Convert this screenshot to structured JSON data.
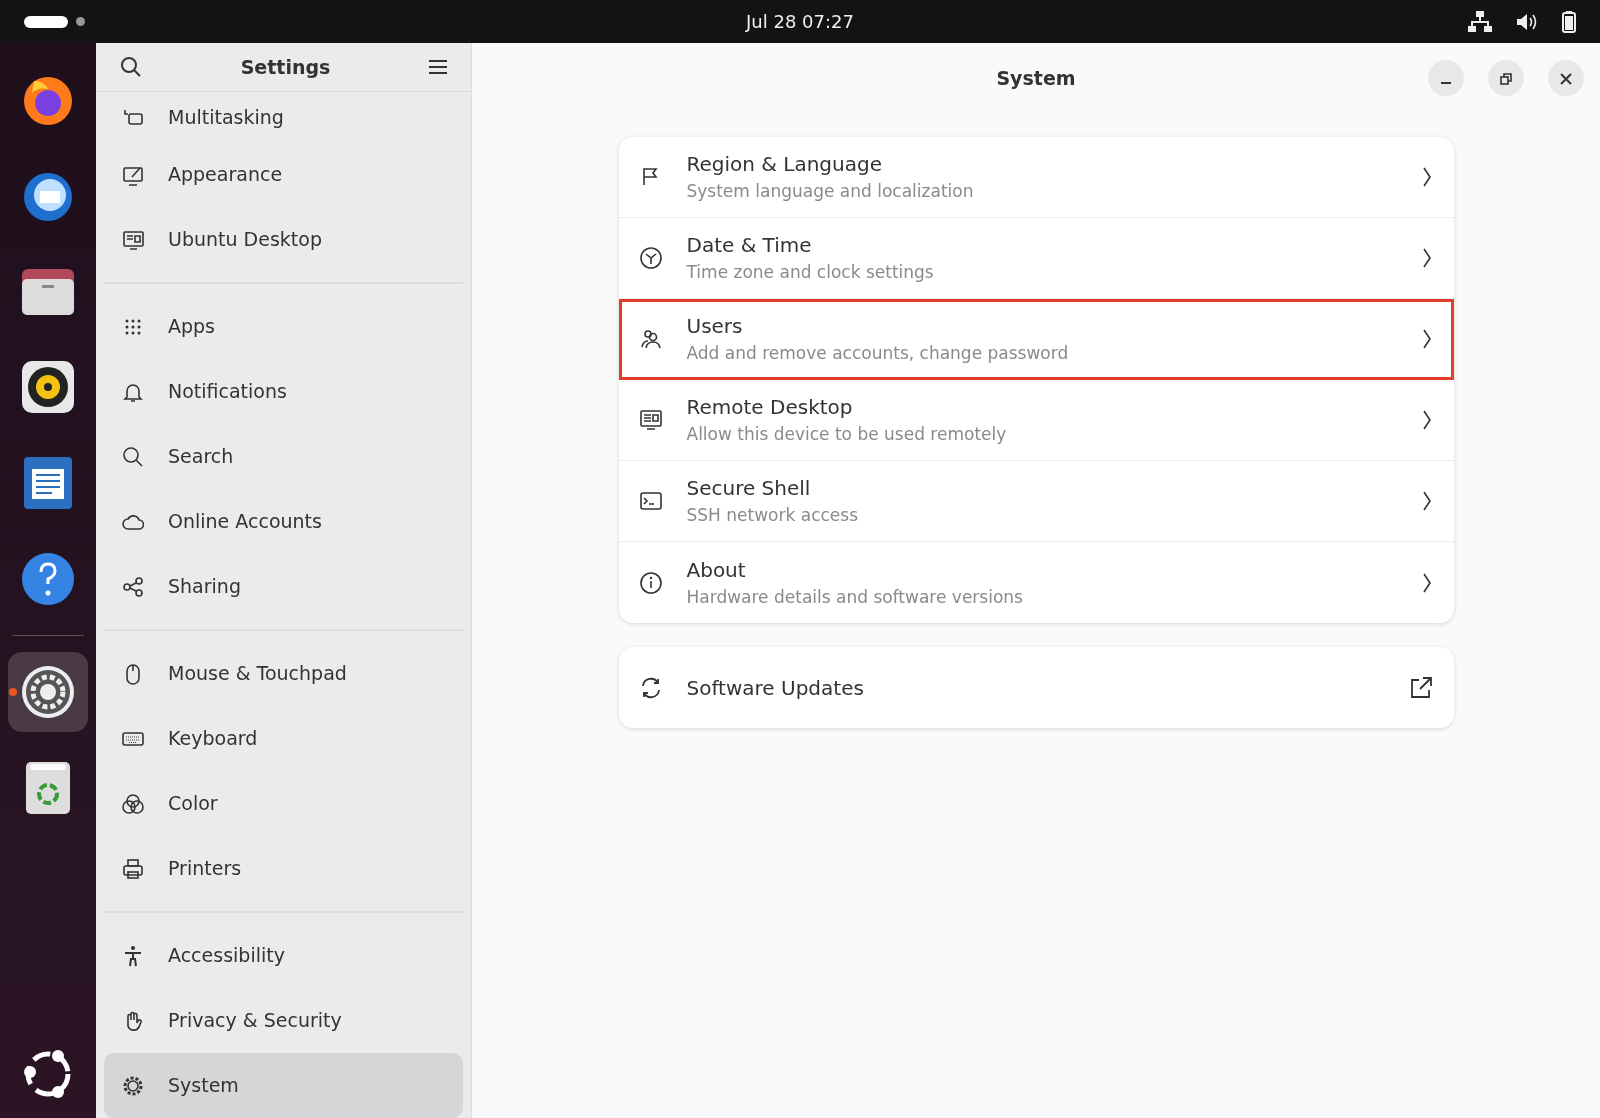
{
  "top_bar": {
    "clock": "Jul 28  07:27"
  },
  "dock": {
    "items": [
      {
        "running": false
      },
      {
        "running": false
      },
      {
        "running": false
      },
      {
        "running": false
      },
      {
        "running": false
      },
      {
        "running": false
      },
      {
        "running": true
      },
      {
        "running": false
      }
    ]
  },
  "sidebar": {
    "title": "Settings",
    "groups": [
      [
        {
          "label": "Multitasking",
          "selected": false
        },
        {
          "label": "Appearance",
          "selected": false
        },
        {
          "label": "Ubuntu Desktop",
          "selected": false
        }
      ],
      [
        {
          "label": "Apps",
          "selected": false
        },
        {
          "label": "Notifications",
          "selected": false
        },
        {
          "label": "Search",
          "selected": false
        },
        {
          "label": "Online Accounts",
          "selected": false
        },
        {
          "label": "Sharing",
          "selected": false
        }
      ],
      [
        {
          "label": "Mouse & Touchpad",
          "selected": false
        },
        {
          "label": "Keyboard",
          "selected": false
        },
        {
          "label": "Color",
          "selected": false
        },
        {
          "label": "Printers",
          "selected": false
        }
      ],
      [
        {
          "label": "Accessibility",
          "selected": false
        },
        {
          "label": "Privacy & Security",
          "selected": false
        },
        {
          "label": "System",
          "selected": true
        }
      ]
    ]
  },
  "main": {
    "title": "System",
    "rows": [
      {
        "title": "Region & Language",
        "subtitle": "System language and localization",
        "highlighted": false
      },
      {
        "title": "Date & Time",
        "subtitle": "Time zone and clock settings",
        "highlighted": false
      },
      {
        "title": "Users",
        "subtitle": "Add and remove accounts, change password",
        "highlighted": true
      },
      {
        "title": "Remote Desktop",
        "subtitle": "Allow this device to be used remotely",
        "highlighted": false
      },
      {
        "title": "Secure Shell",
        "subtitle": "SSH network access",
        "highlighted": false
      },
      {
        "title": "About",
        "subtitle": "Hardware details and software versions",
        "highlighted": false
      }
    ],
    "external_row": {
      "title": "Software Updates"
    }
  }
}
